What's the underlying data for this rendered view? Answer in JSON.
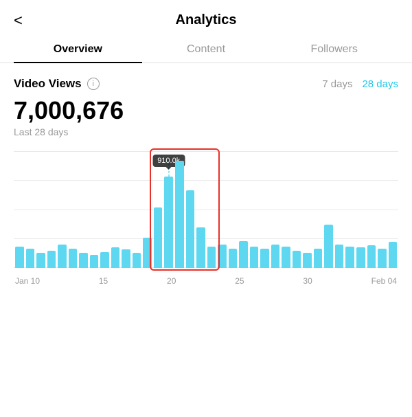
{
  "header": {
    "back_label": "<",
    "title": "Analytics"
  },
  "tabs": [
    {
      "id": "overview",
      "label": "Overview",
      "active": true
    },
    {
      "id": "content",
      "label": "Content",
      "active": false
    },
    {
      "id": "followers",
      "label": "Followers",
      "active": false
    }
  ],
  "section": {
    "title": "Video Views",
    "info_icon": "i",
    "time_options": [
      {
        "label": "7 days",
        "active": false
      },
      {
        "label": "28 days",
        "active": true
      }
    ],
    "big_number": "7,000,676",
    "sub_label": "Last 28 days"
  },
  "chart": {
    "tooltip_value": "910.0k",
    "highlighted_bar_index": 15,
    "x_labels": [
      "Jan 10",
      "15",
      "20",
      "25",
      "30",
      "Feb 04"
    ],
    "bars": [
      20,
      18,
      14,
      16,
      22,
      18,
      14,
      12,
      15,
      19,
      17,
      14,
      28,
      56,
      85,
      100,
      72,
      38,
      20,
      22,
      18,
      25,
      20,
      18,
      22,
      20,
      16,
      14,
      18,
      40,
      22,
      20,
      19,
      21,
      18,
      24
    ]
  },
  "colors": {
    "accent_blue": "#20c8e8",
    "bar_color": "#5dd8f0",
    "highlight_red": "#e8302a",
    "active_tab_underline": "#000"
  }
}
